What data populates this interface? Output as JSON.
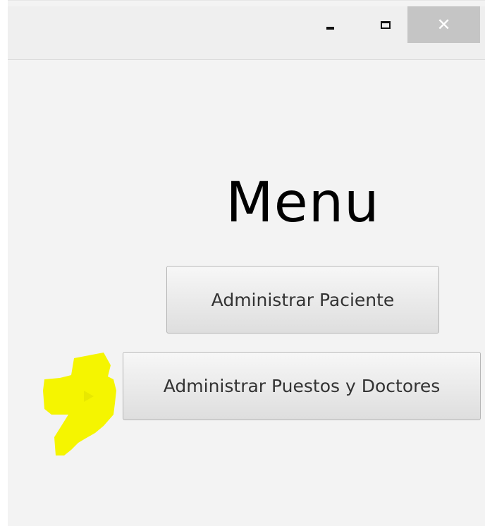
{
  "window": {
    "controls": {
      "minimize_icon": "minimize-icon",
      "maximize_icon": "maximize-icon",
      "close_icon": "close-icon",
      "close_glyph": "✕"
    }
  },
  "main": {
    "title": "Menu",
    "buttons": [
      {
        "label": "Administrar Paciente"
      },
      {
        "label": "Administrar Puestos y Doctores"
      }
    ]
  },
  "annotation": {
    "color": "#f5f500"
  },
  "colors": {
    "window_bg": "#f3f3f3",
    "titlebar_bg": "#efefef",
    "close_bg": "#c5c5c5"
  }
}
